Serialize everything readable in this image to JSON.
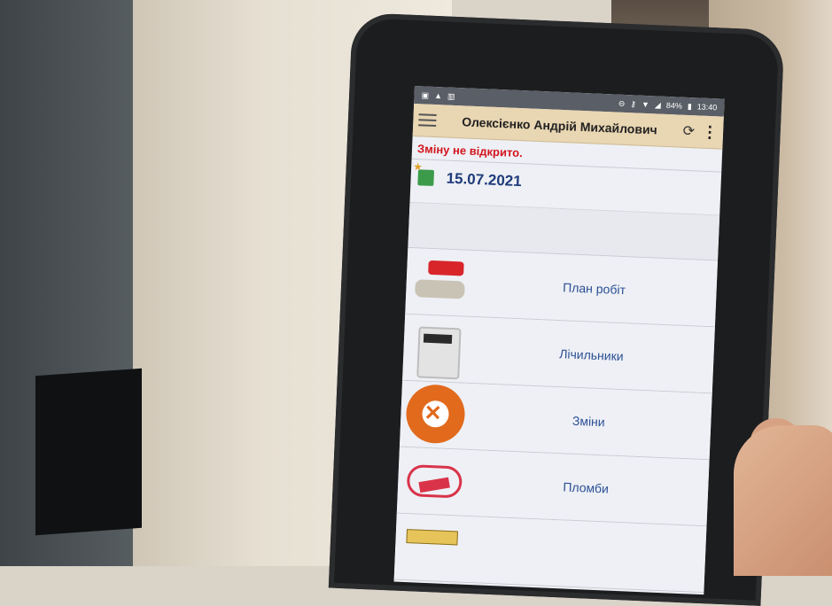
{
  "status_bar": {
    "battery": "84%",
    "time": "13:40"
  },
  "app_bar": {
    "title": "Олексієнко Андрій Михайлович"
  },
  "warning_text": "Зміну не відкрито.",
  "date": "15.07.2021",
  "menu": [
    {
      "label": "План робіт",
      "icon": "valve-icon"
    },
    {
      "label": "Лічильники",
      "icon": "gas-meter-icon"
    },
    {
      "label": "Зміни",
      "icon": "gear-tools-icon"
    },
    {
      "label": "Пломби",
      "icon": "seal-icon"
    }
  ],
  "colors": {
    "app_bar": "#e9d6b2",
    "warning": "#d2141c",
    "date": "#1f3b7a",
    "menu_label": "#2b4f95"
  }
}
